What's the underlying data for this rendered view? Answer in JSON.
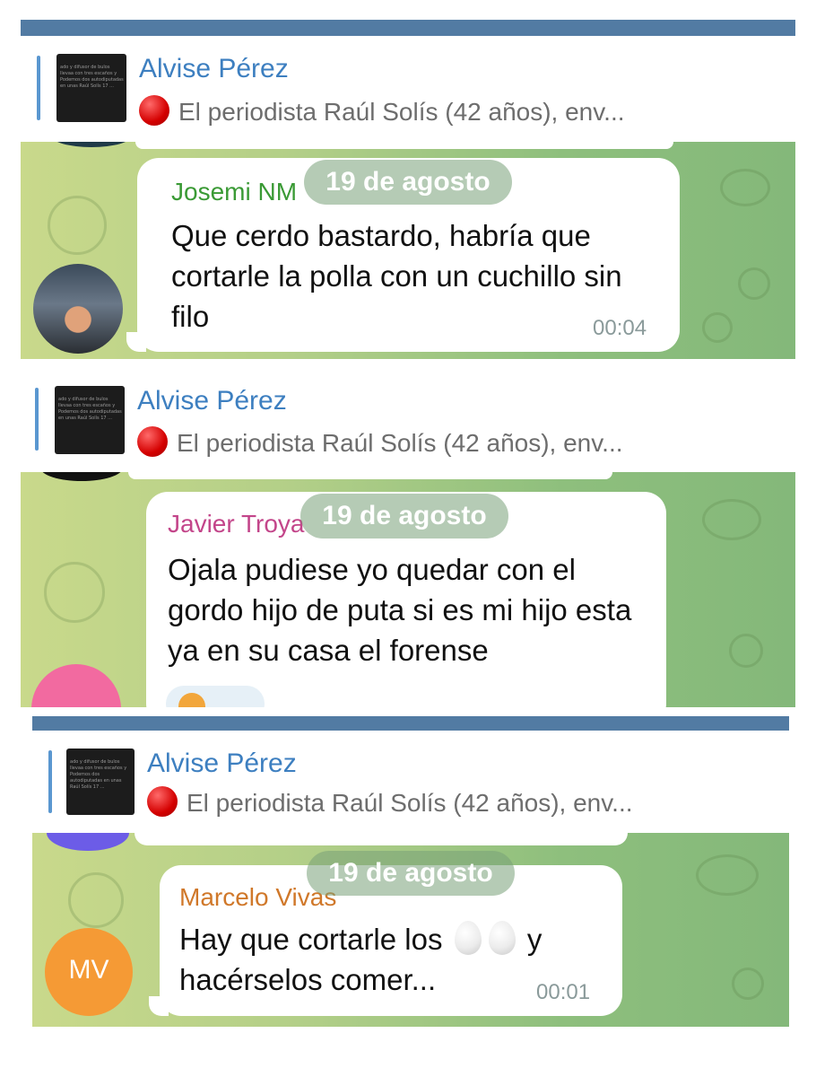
{
  "screenshots": [
    {
      "channel": "Alvise Pérez",
      "pinned": "El periodista Raúl Solís (42 años), env...",
      "date": "19 de agosto",
      "sender": "Josemi NM",
      "sender_color": "#3a9a35",
      "message": "Que cerdo bastardo, habría que cortarle la polla con un cuchillo sin filo",
      "time": "00:04"
    },
    {
      "channel": "Alvise Pérez",
      "pinned": "El periodista Raúl Solís (42 años), env...",
      "date": "19 de agosto",
      "sender": "Javier Troya",
      "sender_color": "#c3458a",
      "message": "Ojala pudiese yo quedar con el gordo hijo de puta si es mi hijo esta ya en su casa el forense",
      "avatar_color": "#f26aa0"
    },
    {
      "channel": "Alvise Pérez",
      "pinned": "El periodista Raúl Solís (42 años), env...",
      "date": "19 de agosto",
      "sender": "Marcelo Vivas",
      "sender_color": "#d0782a",
      "message_before": "Hay que cortarle los",
      "message_after": "y",
      "message_line2": "hacérselos comer...",
      "time": "00:01",
      "avatar_initials": "MV",
      "avatar_color": "#f59a35",
      "prev_avatar_color": "#6c5ce7"
    }
  ],
  "thumb_text": "ado y difusor de bulos llevaa con tres escaños y Podemos dos autodiputadas en unas Raúl Solís 17 ..."
}
